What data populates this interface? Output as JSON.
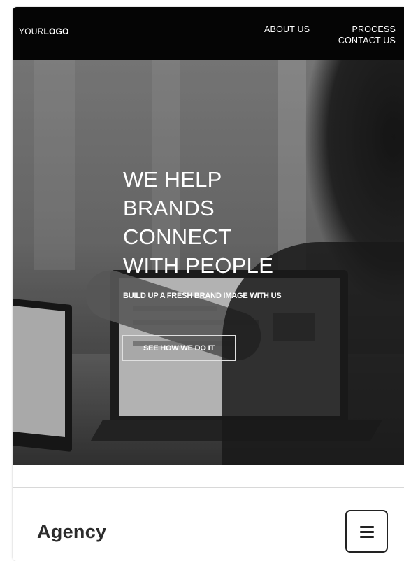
{
  "nav": {
    "logo_light": "YOUR",
    "logo_bold": "LOGO",
    "links": [
      "ABOUT US",
      "PROCESS",
      "CONTACT US"
    ]
  },
  "hero": {
    "title_lines": [
      "WE HELP",
      "BRANDS",
      "CONNECT",
      "WITH PEOPLE"
    ],
    "subtitle": "BUILD UP A FRESH BRAND IMAGE WITH US",
    "cta_label": "SEE HOW WE DO IT"
  },
  "footer_bar": {
    "brand": "Agency",
    "menu_icon": "hamburger-menu-icon"
  },
  "colors": {
    "nav_bg": "#050505",
    "text_light": "#ffffff",
    "brand_text": "#2c2c2c"
  }
}
